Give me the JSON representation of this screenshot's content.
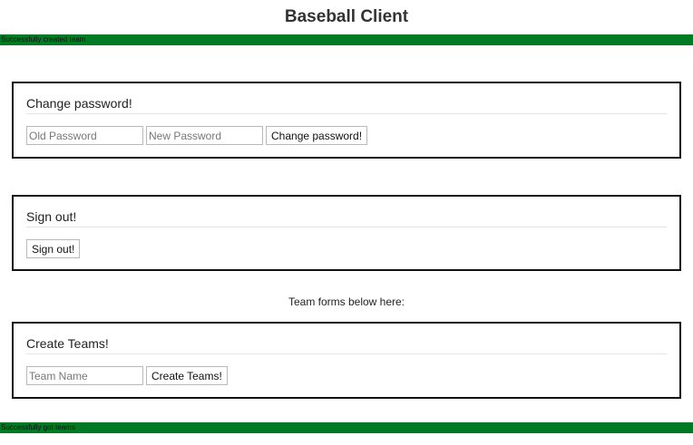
{
  "app": {
    "title": "Baseball Client"
  },
  "status_top": {
    "message": "Successfully created team"
  },
  "change_password": {
    "heading": "Change password!",
    "old_password_placeholder": "Old Password",
    "new_password_placeholder": "New Password",
    "submit_label": "Change password!"
  },
  "sign_out": {
    "heading": "Sign out!",
    "submit_label": "Sign out!"
  },
  "team_note": "Team forms below here:",
  "create_teams": {
    "heading": "Create Teams!",
    "team_name_placeholder": "Team Name",
    "submit_label": "Create Teams!"
  },
  "status_bottom": {
    "message": "Successfully got teams"
  },
  "colors": {
    "status_bar": "#027a25",
    "panel_border": "#111111"
  }
}
